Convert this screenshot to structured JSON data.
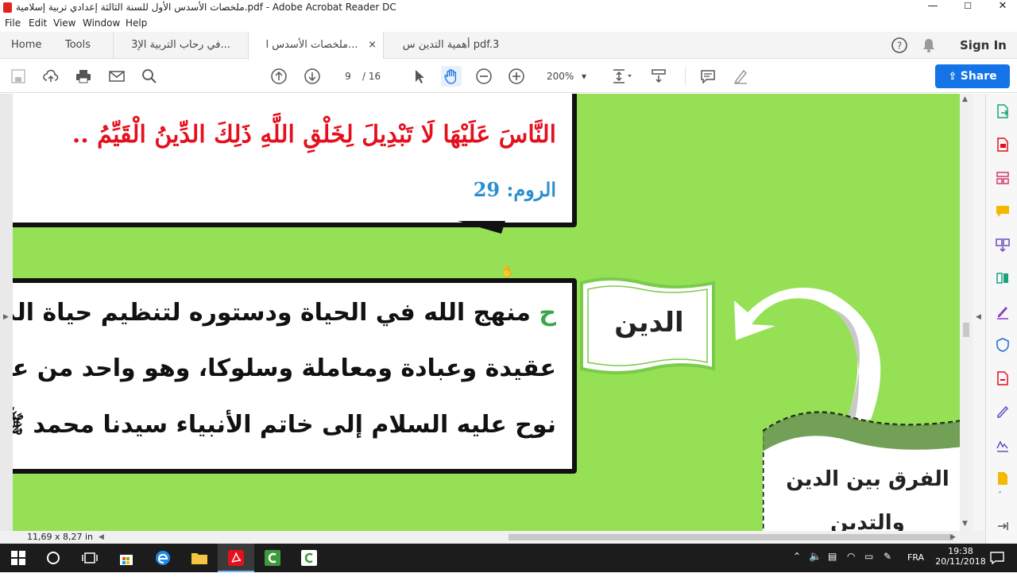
{
  "window": {
    "title": "ملخصات الأسدس الأول للسنة الثالثة إعدادي تربية إسلامية.pdf - Adobe Acrobat Reader DC",
    "min": "—",
    "max": "☐",
    "close": "✕"
  },
  "menu": [
    "File",
    "Edit",
    "View",
    "Window",
    "Help"
  ],
  "tabs": {
    "home": "Home",
    "tools": "Tools",
    "docs": [
      {
        "label": "3في رحاب التربية الإ...",
        "active": false
      },
      {
        "label": "ملخصات الأسدس ا...",
        "active": true,
        "close": "×"
      },
      {
        "label": "أهمية التدين س pdf.3",
        "active": false
      }
    ],
    "help_icon": "?",
    "bell_icon": "bell-icon",
    "sign_in": "Sign In"
  },
  "toolbar": {
    "page_current": "9",
    "page_total": "/ 16",
    "zoom": "200%",
    "zoom_arrow": "▾",
    "share": "Share"
  },
  "document": {
    "ayah_line": "النَّاسَ عَلَيْهَا لَا تَبْدِيلَ لِخَلْقِ اللَّهِ ذَلِكَ الدِّينُ الْقَيِّمُ ..",
    "ayah_ref": "الروم: 29",
    "def_lines": [
      "منهج الله في الحياة ودستوره لتنظيم حياة المسلم",
      "عقيدة وعبادة ومعاملة وسلوكا، وهو واحد من عند",
      "نوح عليه السلام إلى خاتم الأنبياء سيدنا محمد ﷺ."
    ],
    "def_marker": "ح",
    "flag_label": "الدين",
    "diff_line1": "الفرق بين الدين",
    "diff_line2": "والتدين"
  },
  "statusbar": {
    "page_size": "11,69 x 8,27 in"
  },
  "taskbar": {
    "lang": "FRA",
    "time": "19:38",
    "date": "20/11/2018"
  },
  "colors": {
    "page_green": "#95e055",
    "ayah_red": "#e4101e",
    "ref_blue": "#2a8fd0",
    "share_blue": "#1473e6"
  }
}
